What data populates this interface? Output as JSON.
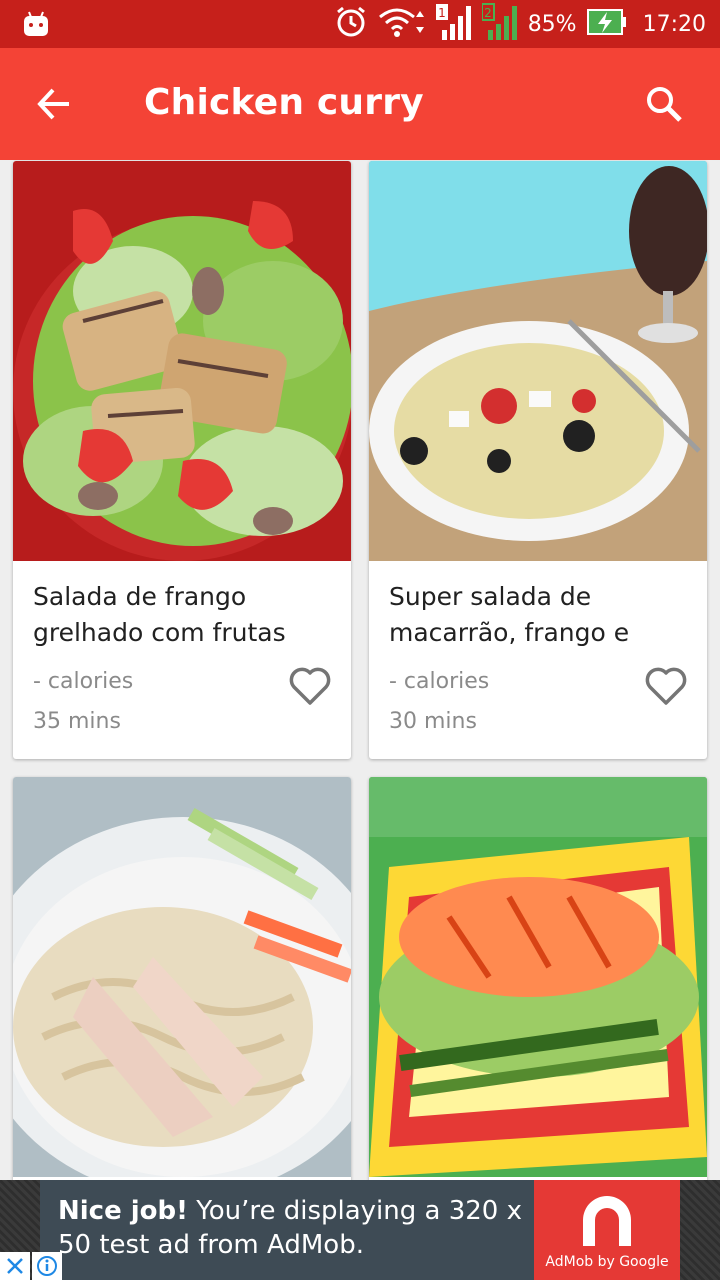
{
  "status_bar": {
    "battery_percent": "85%",
    "time": "17:20",
    "icons": [
      "android-notification-icon",
      "alarm-icon",
      "wifi-icon",
      "signal-sim1-icon",
      "signal-sim2-icon",
      "battery-charging-icon"
    ]
  },
  "app_bar": {
    "title": "Chicken curry",
    "back_icon": "arrow-back-icon",
    "search_icon": "search-icon",
    "color": "#f44336"
  },
  "recipes": [
    {
      "title": "Salada de frango grelhado com frutas",
      "calories": "- calories",
      "time": "35 mins"
    },
    {
      "title": "Super salada de macarrão, frango e",
      "calories": "- calories",
      "time": "30 mins"
    },
    {
      "title": "",
      "calories": "",
      "time": ""
    },
    {
      "title": "",
      "calories": "",
      "time": ""
    }
  ],
  "ad": {
    "bold": "Nice job!",
    "text": " You’re displaying a 320 x 50 test ad from AdMob.",
    "brand": "AdMob by Google"
  }
}
